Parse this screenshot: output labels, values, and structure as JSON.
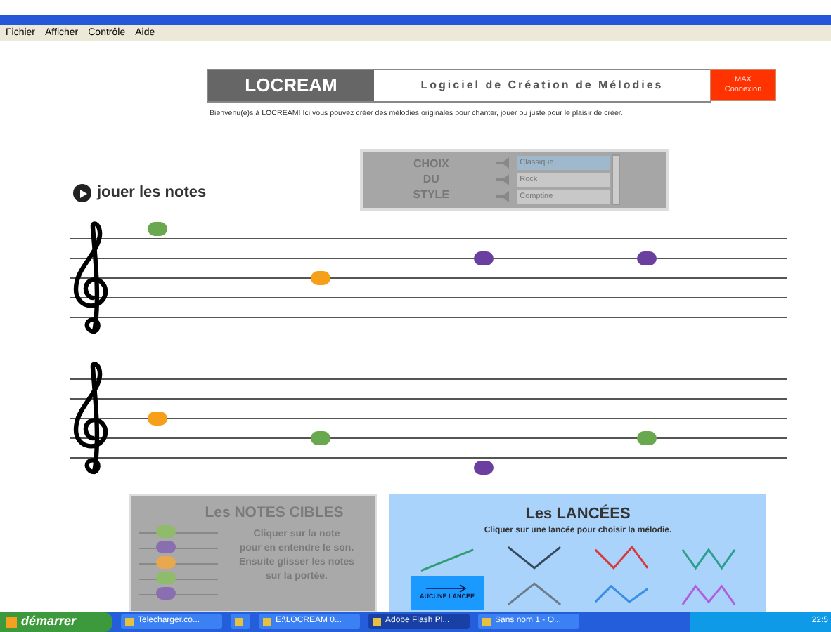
{
  "menu": [
    "Fichier",
    "Afficher",
    "Contrôle",
    "Aide"
  ],
  "header": {
    "logo": "LOCREAM",
    "subtitle": "Logiciel de Création de Mélodies",
    "login_button": [
      "MAX",
      "Connexion"
    ]
  },
  "welcome": "Bienvenu(e)s à LOCREAM! Ici vous pouvez créer des mélodies originales pour chanter, jouer ou juste pour le plaisir de créer.",
  "style_chooser": {
    "label": [
      "CHOIX",
      "DU",
      "STYLE"
    ],
    "options": [
      {
        "label": "Classique",
        "selected": true
      },
      {
        "label": "Rock",
        "selected": false
      },
      {
        "label": "Comptine",
        "selected": false
      }
    ]
  },
  "play_label": "jouer les notes",
  "staves": [
    {
      "notes": [
        {
          "kind": "G5",
          "color": "#6aa84f"
        },
        {
          "kind": "B4",
          "color": "#f6a01a"
        },
        {
          "kind": "D5",
          "color": "#6b3fa0"
        },
        {
          "kind": "D5",
          "color": "#6b3fa0"
        }
      ]
    },
    {
      "notes": [
        {
          "kind": "B4",
          "color": "#f6a01a"
        },
        {
          "kind": "G4",
          "color": "#6aa84f"
        },
        {
          "kind": "D4",
          "color": "#6b3fa0"
        },
        {
          "kind": "G4",
          "color": "#6aa84f"
        }
      ]
    }
  ],
  "target_notes": {
    "title": "Les NOTES CIBLES",
    "instructions": [
      "Cliquer sur la note",
      "pour en entendre le son.",
      "Ensuite glisser les notes",
      "sur la portée."
    ],
    "notes": [
      {
        "color": "#8fbc6a"
      },
      {
        "color": "#8a6fb0"
      },
      {
        "color": "#e8a850"
      },
      {
        "color": "#8fbc6a"
      },
      {
        "color": "#8a6fb0"
      }
    ]
  },
  "lancees": {
    "title": "Les LANCÉES",
    "instruction": "Cliquer sur une lancée pour choisir la mélodie.",
    "none_button": "AUCUNE LANCÉE",
    "items": [
      {
        "kind": "rise",
        "color": "#2e9e6e"
      },
      {
        "kind": "valley",
        "color": "#34495e"
      },
      {
        "kind": "zigzag",
        "color": "#d9383a"
      },
      {
        "kind": "w",
        "color": "#2e9e8e"
      },
      {
        "kind": "peak",
        "color": "#6b7b8a"
      },
      {
        "kind": "wave",
        "color": "#3a8ee6"
      },
      {
        "kind": "m",
        "color": "#b05ee0"
      }
    ]
  },
  "taskbar": {
    "start": "démarrer",
    "tasks": [
      {
        "label": "Telecharger.co...",
        "selected": false
      },
      {
        "selected": false
      },
      {
        "label": "E:\\LOCREAM 0...",
        "selected": false
      },
      {
        "label": "Adobe Flash Pl...",
        "selected": true
      },
      {
        "label": "Sans nom 1 - O...",
        "selected": false
      }
    ],
    "clock": "22:5"
  }
}
